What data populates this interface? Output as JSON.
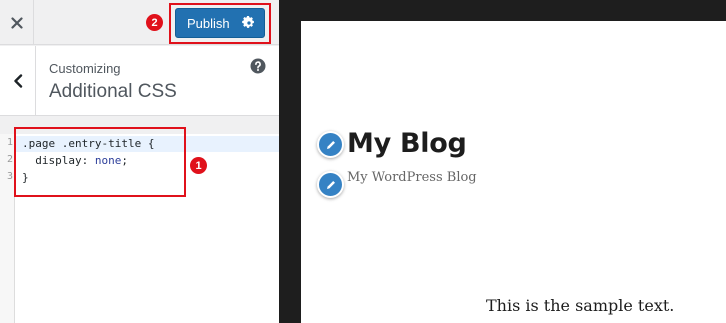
{
  "header": {
    "publish_label": "Publish"
  },
  "section": {
    "breadcrumb": "Customizing",
    "title": "Additional CSS"
  },
  "editor": {
    "line_numbers": [
      "1",
      "2",
      "3"
    ],
    "lines": {
      "l1": ".page .entry-title {",
      "l2_prop": "  display: ",
      "l2_value": "none",
      "l2_end": ";",
      "l3": "}"
    }
  },
  "annotations": {
    "badge1": "1",
    "badge2": "2",
    "color": "#e0111b"
  },
  "preview": {
    "site_title": "My Blog",
    "tagline": "My WordPress Blog",
    "sample_text": "This is the sample text."
  },
  "icons": [
    "close-icon",
    "gear-icon",
    "chevron-left-icon",
    "help-icon",
    "pencil-icon"
  ],
  "colors": {
    "primary": "#2271b1",
    "pencil": "#3582c4",
    "frame": "#1e1e1e"
  }
}
